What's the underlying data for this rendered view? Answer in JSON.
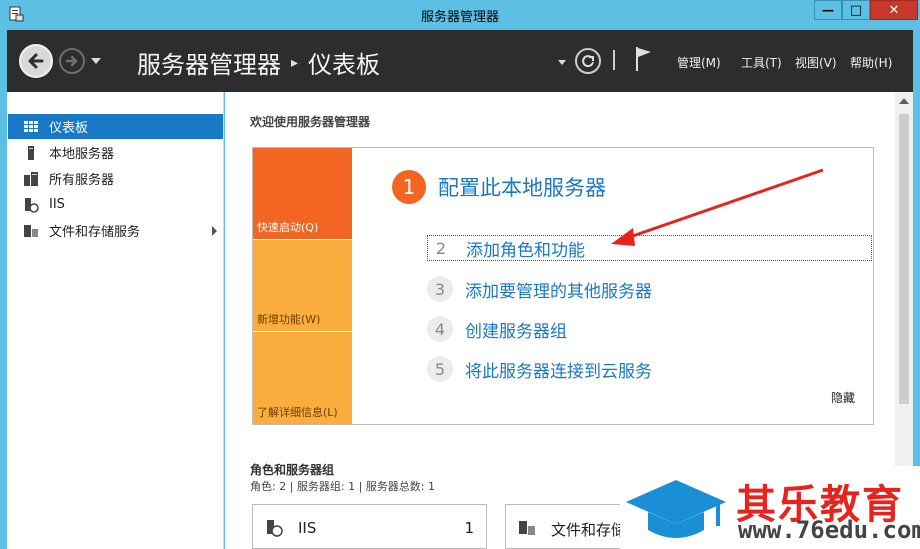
{
  "window": {
    "title": "服务器管理器",
    "min_glyph": "—",
    "max_glyph": "□",
    "close_glyph": "✕"
  },
  "header": {
    "crumb_root": "服务器管理器",
    "crumb_sep": "▸",
    "crumb_current": "仪表板",
    "menus": [
      "管理(M)",
      "工具(T)",
      "视图(V)",
      "帮助(H)"
    ]
  },
  "sidebar": {
    "items": [
      {
        "label": "仪表板",
        "icon": "dashboard-icon",
        "active": true
      },
      {
        "label": "本地服务器",
        "icon": "server-icon"
      },
      {
        "label": "所有服务器",
        "icon": "servers-icon"
      },
      {
        "label": "IIS",
        "icon": "iis-icon"
      },
      {
        "label": "文件和存储服务",
        "icon": "storage-icon",
        "expandable": true
      }
    ]
  },
  "main": {
    "welcome": "欢迎使用服务器管理器",
    "tiles": [
      "快速启动(Q)",
      "新增功能(W)",
      "了解详细信息(L)"
    ],
    "step1": {
      "num": "1",
      "text": "配置此本地服务器"
    },
    "steps": [
      {
        "num": "2",
        "text": "添加角色和功能"
      },
      {
        "num": "3",
        "text": "添加要管理的其他服务器"
      },
      {
        "num": "4",
        "text": "创建服务器组"
      },
      {
        "num": "5",
        "text": "将此服务器连接到云服务"
      }
    ],
    "hide": "隐藏",
    "roles_title": "角色和服务器组",
    "roles_subtitle": "角色: 2 | 服务器组: 1 | 服务器总数: 1",
    "cards": [
      {
        "name": "IIS",
        "count": "1"
      },
      {
        "name": "文件和存储"
      }
    ]
  },
  "watermark": {
    "title": "其乐教育",
    "url": "www.76edu.com"
  },
  "colors": {
    "accent_blue": "#1a79c7",
    "orange": "#f26522",
    "amber": "#fbad3e",
    "header_dark": "#2d2d30",
    "red_arrow": "#e8221d"
  }
}
